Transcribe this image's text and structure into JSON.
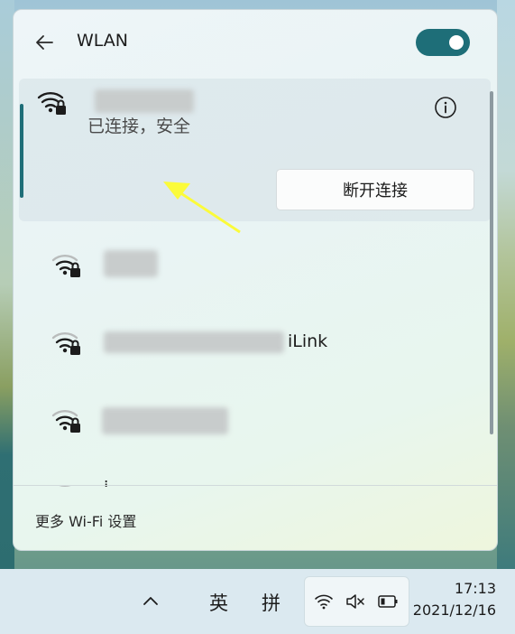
{
  "flyout": {
    "title": "WLAN",
    "wifi_enabled": true,
    "accent_color": "#1e6e78"
  },
  "networks": {
    "connected": {
      "name_blurred": true,
      "status": "已连接，安全",
      "disconnect_label": "断开连接",
      "secured": true
    },
    "items": [
      {
        "name": "",
        "name_blurred": true,
        "secured": true
      },
      {
        "name": "iLink",
        "name_blurred_prefix": true,
        "secured": true
      },
      {
        "name": "",
        "name_blurred": true,
        "secured": true
      },
      {
        "name": "i",
        "name_blurred_prefix": false,
        "secured": true
      }
    ]
  },
  "footer": {
    "more_settings_label": "更多 Wi-Fi 设置"
  },
  "taskbar": {
    "ime_mode": "英",
    "ime_input": "拼",
    "time": "17:13",
    "date": "2021/12/16",
    "icons": [
      "chevron-up-icon",
      "wifi-icon",
      "volume-muted-icon",
      "battery-icon"
    ]
  }
}
